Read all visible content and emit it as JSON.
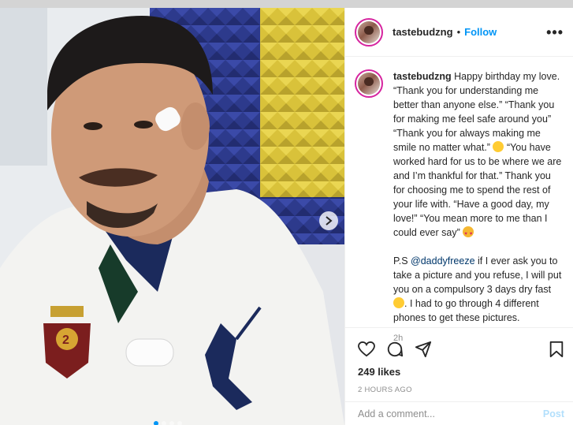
{
  "post": {
    "username": "tastebudzng",
    "separator": "•",
    "follow_label": "Follow",
    "more_label": "•••"
  },
  "caption": {
    "username": "tastebudzng",
    "text_part1": "Happy birthday my love. “Thank you for understanding me better than anyone else.” “Thank you for making me feel safe around you” “Thank you for always making me smile no matter what.”",
    "text_part2": "“You have worked hard for us to be where we are and I’m thankful for that.” Thank you for choosing me to spend the rest of your life with. “Have a good day, my love!” “You mean more to me than I could ever say”",
    "ps_prefix": "P.S",
    "mention": "@daddyfreeze",
    "ps_part1": "if I ever ask you to take a picture and you refuse, I will put you on a compulsory 3 days dry fast",
    "ps_part2": ". I had to go through 4 different phones to get these pictures.",
    "age": "2h",
    "emojis": [
      "grinning-face",
      "smiling-face-with-heart-eyes",
      "grinning-squinting-face"
    ]
  },
  "actions": {
    "likes": "249 likes",
    "posted_time": "2 HOURS AGO",
    "icons": [
      "heart-icon",
      "comment-icon",
      "share-icon",
      "bookmark-icon"
    ]
  },
  "comment": {
    "placeholder": "Add a comment...",
    "post_label": "Post"
  },
  "carousel": {
    "slides": 4,
    "active_slide": 1
  },
  "colors": {
    "accent": "#0095f6",
    "text": "#262626",
    "muted": "#8e8e8e",
    "mention": "#00376b"
  }
}
